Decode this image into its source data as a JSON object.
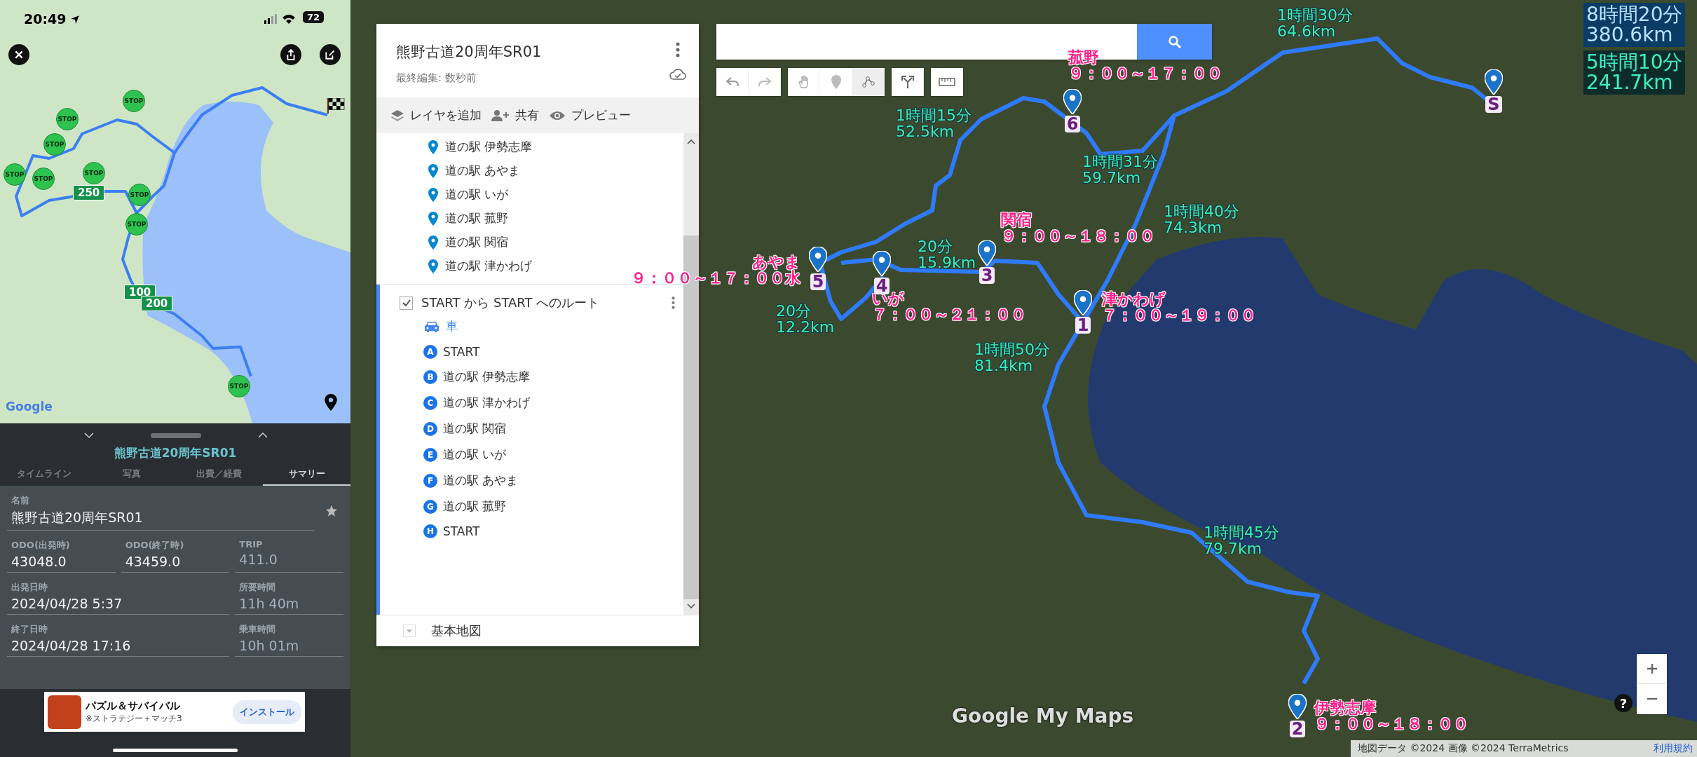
{
  "phone": {
    "status_bar": {
      "time": "20:49",
      "battery": "72"
    },
    "map": {
      "logo": "Google",
      "stop_markers": [
        {
          "label": "STOP"
        },
        {
          "label": "STOP"
        },
        {
          "label": "STOP"
        },
        {
          "label": "STOP"
        },
        {
          "label": "STOP"
        },
        {
          "label": "STOP"
        },
        {
          "label": "STOP"
        },
        {
          "label": "STOP"
        },
        {
          "label": "STOP"
        }
      ],
      "distance_markers": [
        "250",
        "100",
        "200"
      ]
    },
    "trip": {
      "title": "熊野古道20周年SR01",
      "tabs": [
        {
          "label": "タイムライン",
          "selected": false
        },
        {
          "label": "写真",
          "selected": false
        },
        {
          "label": "出費／経費",
          "selected": false
        },
        {
          "label": "サマリー",
          "selected": true
        }
      ],
      "name_field": {
        "label": "名前",
        "value": "熊野古道20周年SR01"
      },
      "field_rows": [
        [
          {
            "label": "ODO(出発時)",
            "value": "43048.0",
            "disabled": false
          },
          {
            "label": "ODO(終了時)",
            "value": "43459.0",
            "disabled": false
          },
          {
            "label": "TRIP",
            "value": "411.0",
            "disabled": true
          }
        ],
        [
          {
            "label": "出発日時",
            "value": "2024/04/28 5:37",
            "disabled": false
          },
          {
            "label": "所要時間",
            "value": "11h 40m",
            "disabled": true
          }
        ],
        [
          {
            "label": "終了日時",
            "value": "2024/04/28 17:16",
            "disabled": false
          },
          {
            "label": "乗車時間",
            "value": "10h 01m",
            "disabled": true
          }
        ]
      ]
    },
    "ad": {
      "title": "パズル＆サバイバル",
      "subtitle": "※ストラテジー＋マッチ3",
      "button": "インストール"
    }
  },
  "my_maps": {
    "title": "熊野古道20周年SR01",
    "subtitle": "最終編集: 数秒前",
    "actions": [
      {
        "kind": "layers",
        "label": "レイヤを追加"
      },
      {
        "kind": "share",
        "label": "共有"
      },
      {
        "kind": "preview",
        "label": "プレビュー"
      }
    ],
    "places": [
      "道の駅 伊勢志摩",
      "道の駅 あやま",
      "道の駅 いが",
      "道の駅 菰野",
      "道の駅 関宿",
      "道の駅 津かわげ"
    ],
    "route": {
      "title": "START から START へのルート",
      "checked": true,
      "mode": "車",
      "stops": [
        {
          "letter": "A",
          "name": "START"
        },
        {
          "letter": "B",
          "name": "道の駅 伊勢志摩"
        },
        {
          "letter": "C",
          "name": "道の駅 津かわげ"
        },
        {
          "letter": "D",
          "name": "道の駅 関宿"
        },
        {
          "letter": "E",
          "name": "道の駅 いが"
        },
        {
          "letter": "F",
          "name": "道の駅 あやま"
        },
        {
          "letter": "G",
          "name": "道の駅 菰野"
        },
        {
          "letter": "H",
          "name": "START"
        }
      ]
    },
    "base_map": "基本地図"
  },
  "map": {
    "labels": [
      {
        "kind": "segment",
        "lines": [
          "1時間30分",
          "64.6km"
        ]
      },
      {
        "kind": "grand_total",
        "lines": [
          "8時間20分",
          "380.6km"
        ]
      },
      {
        "kind": "stop",
        "lines": [
          "菰野",
          "９：００～１７：００"
        ]
      },
      {
        "kind": "total",
        "lines": [
          "5時間10分",
          "241.7km"
        ]
      },
      {
        "kind": "segment",
        "lines": [
          "1時間15分",
          "52.5km"
        ]
      },
      {
        "kind": "segment",
        "lines": [
          "1時間31分",
          "59.7km"
        ]
      },
      {
        "kind": "segment",
        "lines": [
          "1時間40分",
          "74.3km"
        ]
      },
      {
        "kind": "stop",
        "lines": [
          "関宿",
          "９：００～１８：００"
        ]
      },
      {
        "kind": "segment",
        "lines": [
          "20分",
          "15.9km"
        ]
      },
      {
        "kind": "stop",
        "lines": [
          "あやま",
          "９：００～１７：００水"
        ]
      },
      {
        "kind": "segment",
        "lines": [
          "20分",
          "12.2km"
        ]
      },
      {
        "kind": "stop",
        "lines": [
          "いが",
          "７：００～２１：００"
        ]
      },
      {
        "kind": "stop",
        "lines": [
          "津かわげ",
          "７：００～１９：００"
        ]
      },
      {
        "kind": "segment",
        "lines": [
          "1時間50分",
          "81.4km"
        ]
      },
      {
        "kind": "segment",
        "lines": [
          "1時間45分",
          "79.7km"
        ]
      },
      {
        "kind": "stop",
        "lines": [
          "伊勢志摩",
          "９：００～１８：００"
        ]
      }
    ],
    "pins": [
      {
        "number": "S"
      },
      {
        "number": "6"
      },
      {
        "number": "3"
      },
      {
        "number": "4"
      },
      {
        "number": "5"
      },
      {
        "number": "1"
      },
      {
        "number": "2"
      }
    ],
    "logo": "Google My Maps",
    "help": "?",
    "attribution": "地図データ ©2024 画像 ©2024 TerraMetrics",
    "terms": "利用規約"
  }
}
